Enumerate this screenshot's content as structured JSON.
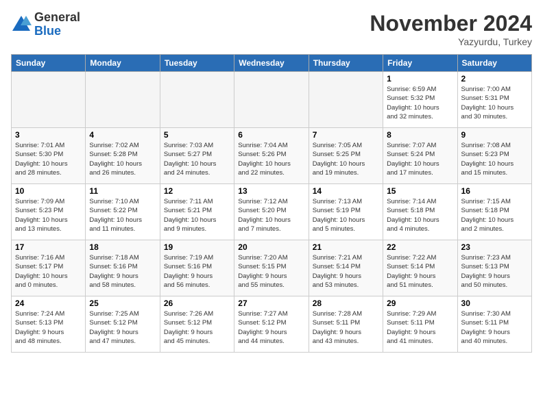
{
  "logo": {
    "general": "General",
    "blue": "Blue"
  },
  "title": "November 2024",
  "location": "Yazyurdu, Turkey",
  "days_header": [
    "Sunday",
    "Monday",
    "Tuesday",
    "Wednesday",
    "Thursday",
    "Friday",
    "Saturday"
  ],
  "weeks": [
    [
      {
        "day": "",
        "info": ""
      },
      {
        "day": "",
        "info": ""
      },
      {
        "day": "",
        "info": ""
      },
      {
        "day": "",
        "info": ""
      },
      {
        "day": "",
        "info": ""
      },
      {
        "day": "1",
        "info": "Sunrise: 6:59 AM\nSunset: 5:32 PM\nDaylight: 10 hours\nand 32 minutes."
      },
      {
        "day": "2",
        "info": "Sunrise: 7:00 AM\nSunset: 5:31 PM\nDaylight: 10 hours\nand 30 minutes."
      }
    ],
    [
      {
        "day": "3",
        "info": "Sunrise: 7:01 AM\nSunset: 5:30 PM\nDaylight: 10 hours\nand 28 minutes."
      },
      {
        "day": "4",
        "info": "Sunrise: 7:02 AM\nSunset: 5:28 PM\nDaylight: 10 hours\nand 26 minutes."
      },
      {
        "day": "5",
        "info": "Sunrise: 7:03 AM\nSunset: 5:27 PM\nDaylight: 10 hours\nand 24 minutes."
      },
      {
        "day": "6",
        "info": "Sunrise: 7:04 AM\nSunset: 5:26 PM\nDaylight: 10 hours\nand 22 minutes."
      },
      {
        "day": "7",
        "info": "Sunrise: 7:05 AM\nSunset: 5:25 PM\nDaylight: 10 hours\nand 19 minutes."
      },
      {
        "day": "8",
        "info": "Sunrise: 7:07 AM\nSunset: 5:24 PM\nDaylight: 10 hours\nand 17 minutes."
      },
      {
        "day": "9",
        "info": "Sunrise: 7:08 AM\nSunset: 5:23 PM\nDaylight: 10 hours\nand 15 minutes."
      }
    ],
    [
      {
        "day": "10",
        "info": "Sunrise: 7:09 AM\nSunset: 5:23 PM\nDaylight: 10 hours\nand 13 minutes."
      },
      {
        "day": "11",
        "info": "Sunrise: 7:10 AM\nSunset: 5:22 PM\nDaylight: 10 hours\nand 11 minutes."
      },
      {
        "day": "12",
        "info": "Sunrise: 7:11 AM\nSunset: 5:21 PM\nDaylight: 10 hours\nand 9 minutes."
      },
      {
        "day": "13",
        "info": "Sunrise: 7:12 AM\nSunset: 5:20 PM\nDaylight: 10 hours\nand 7 minutes."
      },
      {
        "day": "14",
        "info": "Sunrise: 7:13 AM\nSunset: 5:19 PM\nDaylight: 10 hours\nand 5 minutes."
      },
      {
        "day": "15",
        "info": "Sunrise: 7:14 AM\nSunset: 5:18 PM\nDaylight: 10 hours\nand 4 minutes."
      },
      {
        "day": "16",
        "info": "Sunrise: 7:15 AM\nSunset: 5:18 PM\nDaylight: 10 hours\nand 2 minutes."
      }
    ],
    [
      {
        "day": "17",
        "info": "Sunrise: 7:16 AM\nSunset: 5:17 PM\nDaylight: 10 hours\nand 0 minutes."
      },
      {
        "day": "18",
        "info": "Sunrise: 7:18 AM\nSunset: 5:16 PM\nDaylight: 9 hours\nand 58 minutes."
      },
      {
        "day": "19",
        "info": "Sunrise: 7:19 AM\nSunset: 5:16 PM\nDaylight: 9 hours\nand 56 minutes."
      },
      {
        "day": "20",
        "info": "Sunrise: 7:20 AM\nSunset: 5:15 PM\nDaylight: 9 hours\nand 55 minutes."
      },
      {
        "day": "21",
        "info": "Sunrise: 7:21 AM\nSunset: 5:14 PM\nDaylight: 9 hours\nand 53 minutes."
      },
      {
        "day": "22",
        "info": "Sunrise: 7:22 AM\nSunset: 5:14 PM\nDaylight: 9 hours\nand 51 minutes."
      },
      {
        "day": "23",
        "info": "Sunrise: 7:23 AM\nSunset: 5:13 PM\nDaylight: 9 hours\nand 50 minutes."
      }
    ],
    [
      {
        "day": "24",
        "info": "Sunrise: 7:24 AM\nSunset: 5:13 PM\nDaylight: 9 hours\nand 48 minutes."
      },
      {
        "day": "25",
        "info": "Sunrise: 7:25 AM\nSunset: 5:12 PM\nDaylight: 9 hours\nand 47 minutes."
      },
      {
        "day": "26",
        "info": "Sunrise: 7:26 AM\nSunset: 5:12 PM\nDaylight: 9 hours\nand 45 minutes."
      },
      {
        "day": "27",
        "info": "Sunrise: 7:27 AM\nSunset: 5:12 PM\nDaylight: 9 hours\nand 44 minutes."
      },
      {
        "day": "28",
        "info": "Sunrise: 7:28 AM\nSunset: 5:11 PM\nDaylight: 9 hours\nand 43 minutes."
      },
      {
        "day": "29",
        "info": "Sunrise: 7:29 AM\nSunset: 5:11 PM\nDaylight: 9 hours\nand 41 minutes."
      },
      {
        "day": "30",
        "info": "Sunrise: 7:30 AM\nSunset: 5:11 PM\nDaylight: 9 hours\nand 40 minutes."
      }
    ]
  ]
}
